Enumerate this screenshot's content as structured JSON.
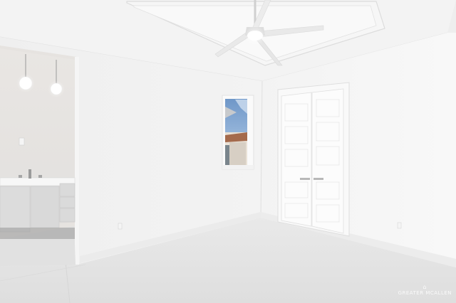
{
  "photo": {
    "watermark_text": "GREATER MCALLEN",
    "watermark_mark": "⌂"
  },
  "colors": {
    "wall_left": "#f1f1f1",
    "wall_right": "#f7f7f7",
    "ceiling": "#f4f4f4",
    "floor": "#e4e4e4",
    "cabinet": "#dcdcdc",
    "sky": "#8fb5de"
  }
}
